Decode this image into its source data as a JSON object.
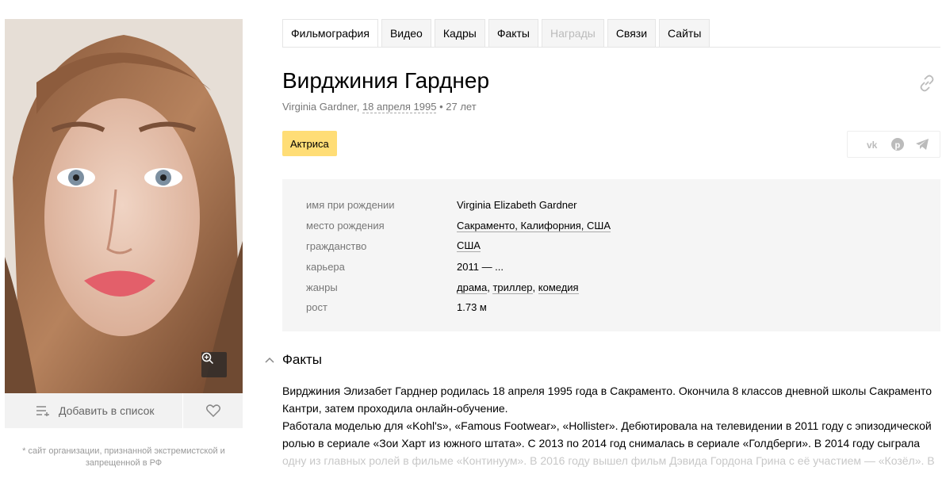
{
  "sidebar": {
    "add_to_list": "Добавить в список",
    "footnote": "* сайт организации, признанной экстремистской и запрещенной в РФ"
  },
  "tabs": [
    {
      "label": "Фильмография",
      "state": "active"
    },
    {
      "label": "Видео",
      "state": "normal"
    },
    {
      "label": "Кадры",
      "state": "normal"
    },
    {
      "label": "Факты",
      "state": "normal"
    },
    {
      "label": "Награды",
      "state": "disabled"
    },
    {
      "label": "Связи",
      "state": "normal"
    },
    {
      "label": "Сайты",
      "state": "normal"
    }
  ],
  "person": {
    "name": "Вирджиния Гарднер",
    "original_name": "Virginia Gardner",
    "birth_date": "18 апреля 1995",
    "age": "27 лет",
    "profession": "Актриса"
  },
  "info": {
    "rows": [
      {
        "label": "имя при рождении",
        "value": "Virginia Elizabeth Gardner"
      },
      {
        "label": "место рождения",
        "value": "Сакраменто, Калифорния, США"
      },
      {
        "label": "гражданство",
        "value": "США"
      },
      {
        "label": "карьера",
        "value": "2011 — ..."
      },
      {
        "label": "жанры",
        "genres": [
          "драма",
          "триллер",
          "комедия"
        ]
      },
      {
        "label": "рост",
        "value": "1.73 м"
      }
    ]
  },
  "facts": {
    "heading": "Факты",
    "p1": "Вирджиния Элизабет Гарднер родилась 18 апреля 1995 года в Сакраменто. Окончила 8 классов дневной школы Сакраменто Кантри, затем проходила онлайн-обучение.",
    "p2": "Работала моделью для «Kohl's», «Famous Footwear», «Hollister». Дебютировала на телевидении в 2011 году с эпизодической ролью в сериале «Зои Харт из южного штата». С 2013 по 2014 год снималась в сериале «Голдберги». В 2014 году сыграла",
    "p2_fade": "одну из главных ролей в фильме «Континуум». В 2016 году вышел фильм Дэвида Гордона Грина с её участием — «Козёл». В"
  },
  "colors": {
    "accent": "#ffdd76",
    "info_bg": "#f5f5f5"
  }
}
